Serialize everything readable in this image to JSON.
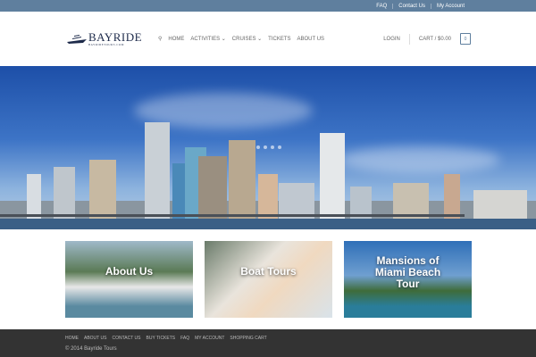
{
  "topbar": {
    "links": [
      "FAQ",
      "Contact Us",
      "My Account"
    ]
  },
  "header": {
    "logo": {
      "name": "BAYRIDE",
      "subtitle": "BAYRIDETOURS.COM"
    },
    "nav": [
      "HOME",
      "ACTIVITIES",
      "CRUISES",
      "TICKETS",
      "ABOUT US"
    ],
    "login": "LOGIN",
    "cart": "CART / $0.00",
    "cart_count": "0"
  },
  "cards": [
    "About Us",
    "Boat Tours",
    "Mansions of Miami Beach Tour"
  ],
  "footer": {
    "links": [
      "HOME",
      "ABOUT US",
      "CONTACT US",
      "BUY TICKETS",
      "FAQ",
      "MY ACCOUNT",
      "SHOPPING CART"
    ],
    "copyright": "© 2014 Bayride Tours"
  },
  "colors": {
    "topbar": "#5f7f9e",
    "footer": "#333333"
  }
}
